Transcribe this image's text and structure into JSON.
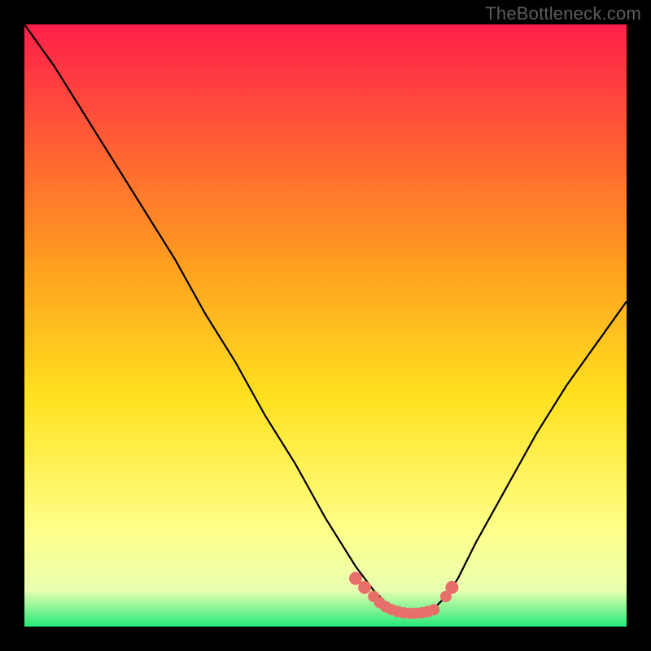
{
  "watermark": "TheBottleneck.com",
  "colors": {
    "curve": "#000000",
    "marker": "#e76f6a",
    "bg_top": "#ff1f4a",
    "bg_mid1": "#ff9f1f",
    "bg_mid2": "#ffe21f",
    "bg_mid3": "#ffff8a",
    "bg_low": "#e8ffb0",
    "bg_bottom": "#26e97a"
  },
  "chart_data": {
    "type": "line",
    "title": "",
    "xlabel": "",
    "ylabel": "",
    "xlim": [
      0,
      100
    ],
    "ylim": [
      0,
      100
    ],
    "series": [
      {
        "name": "bottleneck-curve",
        "x": [
          0,
          5,
          10,
          15,
          20,
          25,
          30,
          35,
          40,
          45,
          50,
          55,
          58,
          60,
          62,
          64,
          66,
          68,
          70,
          72,
          75,
          80,
          85,
          90,
          95,
          100
        ],
        "values": [
          100,
          93,
          85,
          77,
          69,
          61,
          52,
          44,
          35,
          27,
          18,
          10,
          6,
          4,
          3,
          2,
          2,
          3,
          5,
          8,
          14,
          23,
          32,
          40,
          47,
          54
        ]
      }
    ],
    "markers": {
      "name": "highlight-band",
      "x": [
        55.0,
        56.5,
        58.0,
        59.0,
        60.0,
        61.0,
        62.0,
        63.0,
        64.0,
        65.0,
        66.0,
        67.0,
        68.0,
        70.0,
        71.0
      ],
      "values": [
        8.0,
        6.5,
        5.0,
        4.0,
        3.3,
        2.8,
        2.5,
        2.3,
        2.2,
        2.2,
        2.3,
        2.5,
        2.8,
        5.0,
        6.5
      ],
      "radius": [
        8,
        8,
        7,
        7,
        7,
        7,
        7,
        7,
        7,
        7,
        7,
        7,
        7,
        7,
        8
      ]
    }
  }
}
